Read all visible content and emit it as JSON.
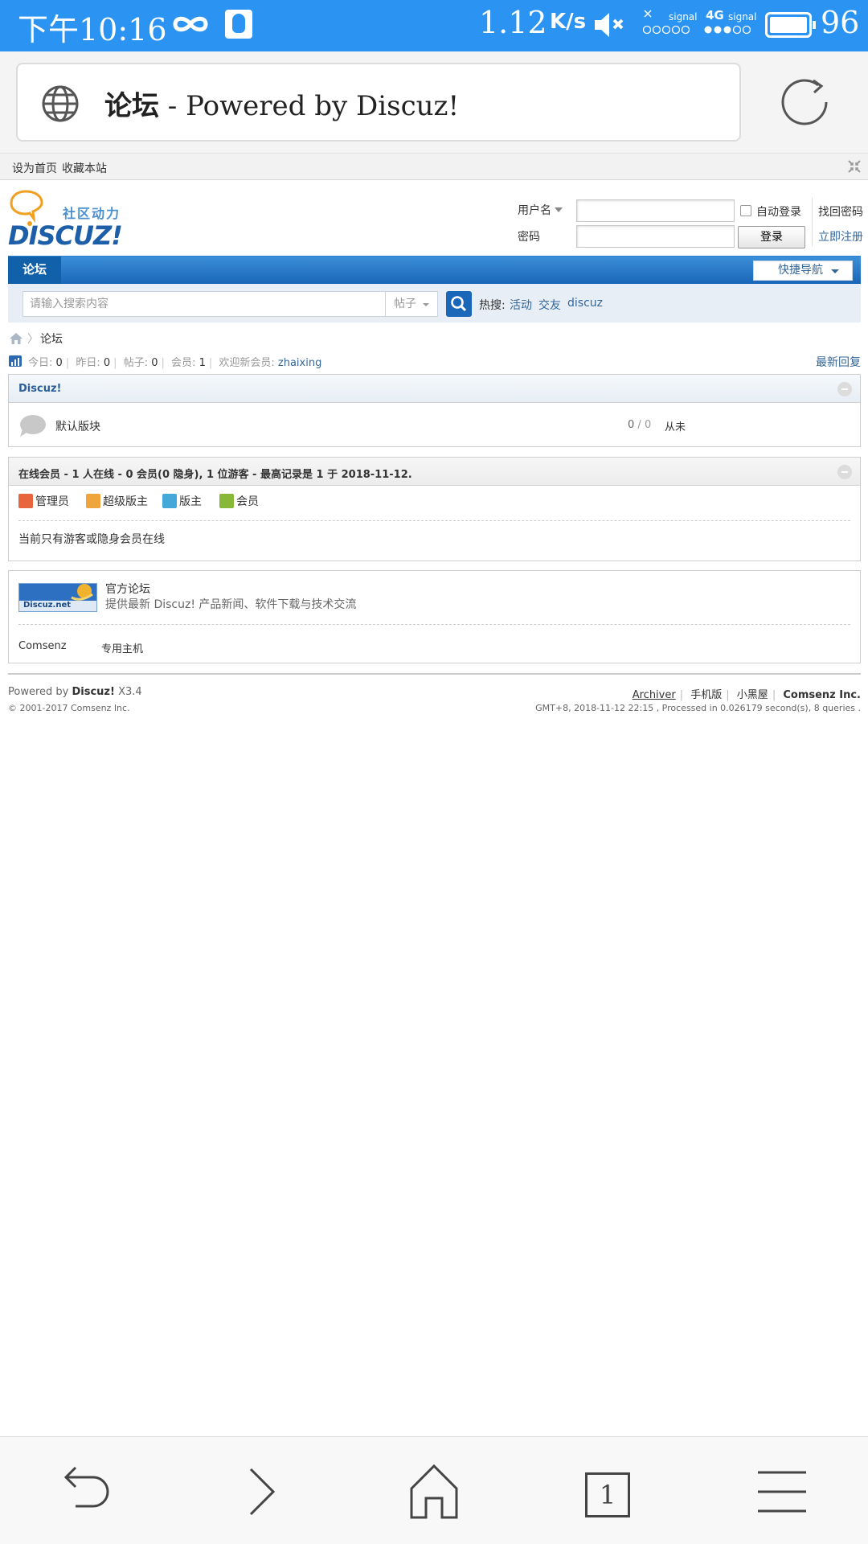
{
  "status_bar": {
    "time": "下午10:16",
    "speed": "1.12",
    "speed_unit": "K/s",
    "signal_label": "signal",
    "network": "4G",
    "battery": "96"
  },
  "browser": {
    "page_title_bold": "论坛",
    "page_title_rest": " - Powered by Discuz!"
  },
  "topbar": {
    "set_home": "设为首页",
    "bookmark": "收藏本站"
  },
  "header": {
    "logo_cn": "社区动力",
    "logo_en": "DISCUZ!",
    "username_label": "用户名",
    "password_label": "密码",
    "auto_login": "自动登录",
    "login_button": "登录",
    "find_password": "找回密码",
    "register": "立即注册"
  },
  "nav": {
    "active_tab": "论坛",
    "quick_nav": "快捷导航"
  },
  "search": {
    "placeholder": "请输入搜索内容",
    "type": "帖子",
    "hot_label": "热搜:",
    "hot": [
      "活动",
      "交友",
      "discuz"
    ]
  },
  "breadcrumb": {
    "current": "论坛"
  },
  "stats": {
    "today_label": "今日:",
    "today": "0",
    "yesterday_label": "昨日:",
    "yesterday": "0",
    "posts_label": "帖子:",
    "posts": "0",
    "members_label": "会员:",
    "members": "1",
    "newest_label": "欢迎新会员:",
    "newest": "zhaixing",
    "latest_replies": "最新回复"
  },
  "forum_group": {
    "title": "Discuz!",
    "forums": [
      {
        "name": "默认版块",
        "count": "0",
        "count_sep": " / ",
        "count2": "0",
        "last": "从未"
      }
    ]
  },
  "online": {
    "title": "在线会员 - 1 人在线 - 0 会员(0 隐身), 1 位游客 - 最高记录是 1 于 2018-11-12.",
    "roles": [
      "管理员",
      "超级版主",
      "版主",
      "会员"
    ],
    "role_colors": [
      "#e8643c",
      "#f0a43c",
      "#44a8d8",
      "#88b838"
    ],
    "note": "当前只有游客或隐身会员在线"
  },
  "links": {
    "logo_text": "Discuz.net",
    "title": "官方论坛",
    "desc": "提供最新 Discuz! 产品新闻、软件下载与技术交流",
    "text_links": [
      "Comsenz",
      "专用主机"
    ]
  },
  "footer": {
    "powered_prefix": "Powered by ",
    "powered_name": "Discuz!",
    "version": " X3.4",
    "copyright": "© 2001-2017 Comsenz Inc.",
    "archiver": "Archiver",
    "mobile": "手机版",
    "blackroom": "小黑屋",
    "company": "Comsenz Inc.",
    "processed": "GMT+8, 2018-11-12 22:15 , Processed in 0.026179 second(s), 8 queries ."
  },
  "bottom_bar": {
    "tab_count": "1"
  }
}
